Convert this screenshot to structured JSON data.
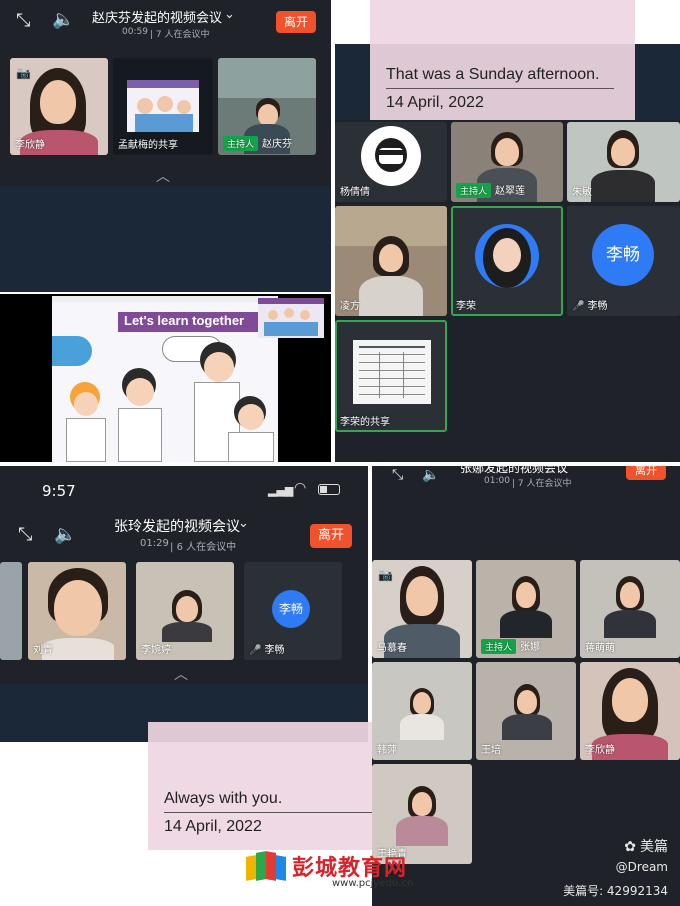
{
  "panel1": {
    "title": "赵庆芬发起的视频会议",
    "duration": "00:59",
    "count": "7 人在会议中",
    "leave": "离开",
    "tiles": [
      {
        "name": "李欣静"
      },
      {
        "name": "孟献梅的共享"
      },
      {
        "host": "主持人",
        "name": "赵庆芬"
      }
    ],
    "slide_title": "Let's learn together"
  },
  "panel2": {
    "note": {
      "line1": "That was a Sunday afternoon.",
      "line2": "14 April, 2022"
    },
    "tiles": [
      {
        "name": "杨倩倩"
      },
      {
        "host": "主持人",
        "name": "赵翠莲"
      },
      {
        "name": "朱敏"
      },
      {
        "name": "凌方"
      },
      {
        "name": "李荣"
      },
      {
        "name": "李畅",
        "avatar": "李畅"
      },
      {
        "name": "李荣的共享"
      }
    ]
  },
  "panel3": {
    "time": "9:57",
    "title": "张玲发起的视频会议",
    "duration": "01:29",
    "count": "6 人在会议中",
    "leave": "离开",
    "tiles": [
      {
        "name": "刘青"
      },
      {
        "name": "李婉婷"
      },
      {
        "name": "李畅",
        "avatar": "李畅"
      }
    ],
    "note": {
      "line1": "Always with you.",
      "line2": "14 April, 2022"
    }
  },
  "panel4": {
    "title": "张娜发起的视频会议",
    "duration": "01:00",
    "count": "7 人在会议中",
    "leave": "离开",
    "tiles": [
      {
        "name": "马慕春"
      },
      {
        "host": "主持人",
        "name": "张娜"
      },
      {
        "name": "蒋萌萌"
      },
      {
        "name": "韩萍"
      },
      {
        "name": "王培"
      },
      {
        "name": "李欣静"
      },
      {
        "name": "王艳青"
      }
    ],
    "watermark": {
      "app": "美篇",
      "user": "@Dream",
      "id": "美篇号: 42992134"
    }
  },
  "logo": {
    "text": "彭城教育网",
    "url": "www.pcjyedu.cn"
  },
  "colors": {
    "leave": "#f0532b",
    "host": "#15a34a",
    "avatar": "#2f7bf5",
    "speaking": "#2fa84f"
  }
}
